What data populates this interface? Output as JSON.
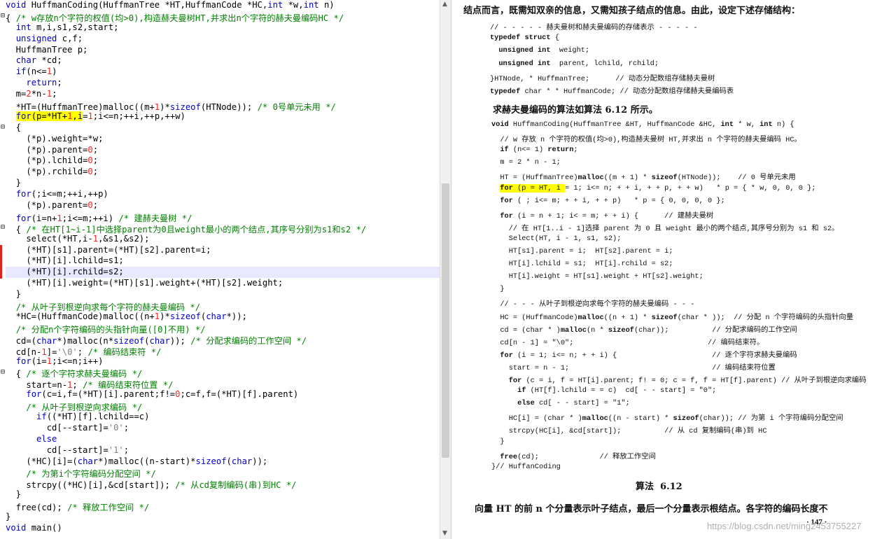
{
  "editor": {
    "lines": [
      "void HuffmanCoding(HuffmanTree *HT,HuffmanCode *HC,int *w,int n)",
      "{ /* w存放n个字符的权值(均>0),构造赫夫曼树HT,并求出n个字符的赫夫曼编码HC */",
      "  int m,i,s1,s2,start;",
      "  unsigned c,f;",
      "  HuffmanTree p;",
      "  char *cd;",
      "  if(n<=1)",
      "    return;",
      "  m=2*n-1;",
      "  *HT=(HuffmanTree)malloc((m+1)*sizeof(HTNode)); /* 0号单元未用 */",
      "  for(p=*HT+1,i=1;i<=n;++i,++p,++w)",
      "  {",
      "    (*p).weight=*w;",
      "    (*p).parent=0;",
      "    (*p).lchild=0;",
      "    (*p).rchild=0;",
      "  }",
      "  for(;i<=m;++i,++p)",
      "    (*p).parent=0;",
      "  for(i=n+1;i<=m;++i) /* 建赫夫曼树 */",
      "  { /* 在HT[1~i-1]中选择parent为0且weight最小的两个结点,其序号分别为s1和s2 */",
      "    select(*HT,i-1,&s1,&s2);",
      "    (*HT)[s1].parent=(*HT)[s2].parent=i;",
      "    (*HT)[i].lchild=s1;",
      "    (*HT)[i].rchild=s2;",
      "    (*HT)[i].weight=(*HT)[s1].weight+(*HT)[s2].weight;",
      "  }",
      "  /* 从叶子到根逆向求每个字符的赫夫曼编码 */",
      "  *HC=(HuffmanCode)malloc((n+1)*sizeof(char*));",
      "  /* 分配n个字符编码的头指针向量([0]不用) */",
      "  cd=(char*)malloc(n*sizeof(char)); /* 分配求编码的工作空间 */",
      "  cd[n-1]='\\0'; /* 编码结束符 */",
      "  for(i=1;i<=n;i++)",
      "  { /* 逐个字符求赫夫曼编码 */",
      "    start=n-1; /* 编码结束符位置 */",
      "    for(c=i,f=(*HT)[i].parent;f!=0;c=f,f=(*HT)[f].parent)",
      "    /* 从叶子到根逆向求编码 */",
      "      if((*HT)[f].lchild==c)",
      "        cd[--start]='0';",
      "      else",
      "        cd[--start]='1';",
      "    (*HC)[i]=(char*)malloc((n-start)*sizeof(char));",
      "    /* 为第i个字符编码分配空间 */",
      "    strcpy((*HC)[i],&cd[start]); /* 从cd复制编码(串)到HC */",
      "  }",
      "  free(cd); /* 释放工作空间 */",
      "}",
      "void main()"
    ],
    "fold_markers": [
      "⊟",
      "⊟",
      "⊟",
      "⊟",
      "⊟",
      "⊟"
    ],
    "scroll_up": "▲",
    "scroll_down": "▼"
  },
  "book": {
    "intro": "结点而言，既需知双亲的信息，又需知孩子结点的信息。由此，设定下述存储结构：",
    "struct_code": [
      "// - - - - - 赫夫曼树和赫夫曼编码的存储表示 - - - - -",
      "typedef struct {",
      "  unsigned int  weight;",
      "  unsigned int  parent, lchild, rchild;",
      "}HTNode, * HuffmanTree;      // 动态分配数组存储赫夫曼树",
      "typedef char * * HuffmanCode; // 动态分配数组存储赫夫曼编码表"
    ],
    "algo_heading": "求赫夫曼编码的算法如算法 6.12 所示。",
    "algo_code": [
      "void HuffmanCoding(HuffmanTree &HT, HuffmanCode &HC, int * w, int n) {",
      "  // w 存放 n 个字符的权值(均>0),构造赫夫曼树 HT,并求出 n 个字符的赫夫曼编码 HC。",
      "  if (n<= 1) return;",
      "  m = 2 * n - 1;",
      "  HT = (HuffmanTree)malloc((m + 1) * sizeof(HTNode));    // 0 号单元未用",
      "  for (p = HT, i = 1; i<= n; + + i, + + p, + + w)   * p = { * w, 0, 0, 0 };",
      "  for ( ; i<= m; + + i, + + p)   * p = { 0, 0, 0, 0 };",
      "  for (i = n + 1; i< = m; + + i) {      // 建赫夫曼树",
      "    // 在 HT[1..i - 1]选择 parent 为 0 且 weight 最小的两个结点,其序号分别为 s1 和 s2。",
      "    Select(HT, i - 1, s1, s2);",
      "    HT[s1].parent = i;  HT[s2].parent = i;",
      "    HT[i].lchild = s1;  HT[i].rchild = s2;",
      "    HT[i].weight = HT[s1].weight + HT[s2].weight;",
      "  }",
      "  // - - - 从叶子到根逆向求每个字符的赫夫曼编码 - - -",
      "  HC = (HuffmanCode)malloc((n + 1) * sizeof(char * ));  // 分配 n 个字符编码的头指针向量",
      "  cd = (char * )malloc(n * sizeof(char));          // 分配求编码的工作空间",
      "  cd[n - 1] = \"\\0\";                               // 编码结束符。",
      "  for (i = 1; i<= n; + + i) {                      // 逐个字符求赫夫曼编码",
      "    start = n - 1;                                 // 编码结束符位置",
      "    for (c = i, f = HT[i].parent; f! = 0; c = f, f = HT[f].parent) // 从叶子到根逆向求编码",
      "      if (HT[f].lchild = = c)  cd[ - - start] = \"0\";",
      "      else cd[ - - start] = \"1\";",
      "    HC[i] = (char * )malloc((n - start) * sizeof(char)); // 为第 i 个字符编码分配空间",
      "    strcpy(HC[i], &cd[start]);          // 从 cd 复制编码(串)到 HC",
      "  }",
      "  free(cd);              // 释放工作空间",
      "}// HuffanCoding"
    ],
    "caption": "算法  6.12",
    "footer_text": "向量 HT 的前 n 个分量表示叶子结点，最后一个分量表示根结点。各字符的编码长度不",
    "page_number": "· 147 ·",
    "watermark": "https://blog.csdn.net/ming2453755227"
  }
}
